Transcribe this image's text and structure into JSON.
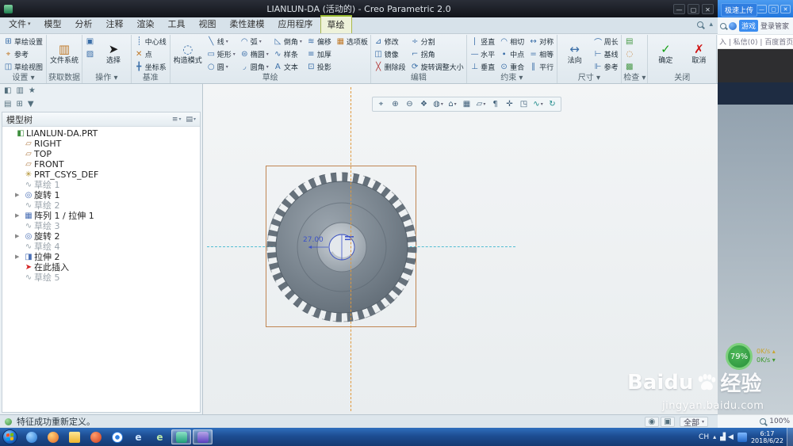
{
  "window": {
    "title": "LIANLUN-DA (活动的) - Creo Parametric 2.0",
    "controls": {
      "minimize": "—",
      "maximize": "▢",
      "close": "✕"
    }
  },
  "tabs": {
    "items": [
      {
        "name": "tab-file",
        "label": "文件",
        "dd": "▾"
      },
      {
        "name": "tab-model",
        "label": "模型"
      },
      {
        "name": "tab-analysis",
        "label": "分析"
      },
      {
        "name": "tab-annotate",
        "label": "注释"
      },
      {
        "name": "tab-render",
        "label": "渲染"
      },
      {
        "name": "tab-tools",
        "label": "工具"
      },
      {
        "name": "tab-view",
        "label": "视图"
      },
      {
        "name": "tab-flexible-modeling",
        "label": "柔性建模"
      },
      {
        "name": "tab-applications",
        "label": "应用程序"
      },
      {
        "name": "tab-sketch",
        "label": "草绘",
        "active": true
      }
    ],
    "collapse_icon": "▴"
  },
  "ribbon": {
    "groups": [
      {
        "label": "设置 ▾",
        "buttons": [
          {
            "n": "sketch-setup-button",
            "g": "⊞",
            "c": "icb",
            "t": "草绘设置"
          },
          {
            "n": "references-button",
            "g": "⌖",
            "c": "ico",
            "t": "参考"
          },
          {
            "n": "sketch-view-button",
            "g": "◫",
            "c": "icb",
            "t": "草绘视图"
          }
        ]
      },
      {
        "label": "获取数据",
        "buttons": [
          {
            "n": "file-system-button",
            "g": "▥",
            "c": "ico",
            "t": "文件系统",
            "big": true
          }
        ]
      },
      {
        "label": "操作 ▾",
        "buttons": [
          {
            "n": "copy-button",
            "g": "▣",
            "c": "icb"
          },
          {
            "n": "paste-button",
            "g": "▨",
            "c": "icb"
          },
          {
            "n": "select-button",
            "g": "➤",
            "c": "ick",
            "t": "选择",
            "big": true
          }
        ]
      },
      {
        "label": "基准",
        "buttons": [
          {
            "n": "centerline-button",
            "g": "┊",
            "c": "icb",
            "t": "中心线"
          },
          {
            "n": "point-button",
            "g": "✕",
            "c": "ico",
            "t": "点"
          },
          {
            "n": "coordinate-system-button",
            "g": "╋",
            "c": "icb",
            "t": "坐标系"
          }
        ]
      },
      {
        "label": "草绘",
        "buttons": [
          {
            "n": "construction-mode-button",
            "g": "◌",
            "c": "icb",
            "t": "构造模式",
            "big": true
          },
          {
            "n": "line-button",
            "g": "╲",
            "c": "icb",
            "t": "线",
            "dd": "▾"
          },
          {
            "n": "rectangle-button",
            "g": "▭",
            "c": "icb",
            "t": "矩形",
            "dd": "▾"
          },
          {
            "n": "circle-button",
            "g": "○",
            "c": "icb",
            "t": "圆",
            "dd": "▾"
          },
          {
            "n": "arc-button",
            "g": "◠",
            "c": "icb",
            "t": "弧",
            "dd": "▾"
          },
          {
            "n": "ellipse-button",
            "g": "⊜",
            "c": "icb",
            "t": "椭圆",
            "dd": "▾"
          },
          {
            "n": "fillet-button",
            "g": "◞",
            "c": "icb",
            "t": "圆角",
            "dd": "▾"
          },
          {
            "n": "chamfer-button",
            "g": "◺",
            "c": "icb",
            "t": "倒角",
            "dd": "▾"
          },
          {
            "n": "spline-button",
            "g": "∿",
            "c": "icb",
            "t": "样条"
          },
          {
            "n": "text-button",
            "g": "A",
            "c": "icb",
            "t": "文本"
          },
          {
            "n": "offset-button",
            "g": "≋",
            "c": "icb",
            "t": "偏移"
          },
          {
            "n": "thicken-button",
            "g": "≡",
            "c": "icb",
            "t": "加厚"
          },
          {
            "n": "project-button",
            "g": "⊡",
            "c": "icb",
            "t": "投影"
          },
          {
            "n": "palette-button",
            "g": "▦",
            "c": "ico",
            "t": "选项板"
          }
        ]
      },
      {
        "label": "编辑",
        "buttons": [
          {
            "n": "modify-button",
            "g": "⊿",
            "c": "icb",
            "t": "修改"
          },
          {
            "n": "mirror-button",
            "g": "◫",
            "c": "icb",
            "t": "镜像"
          },
          {
            "n": "delete-segment-button",
            "g": "╳",
            "c": "icr",
            "t": "删除段"
          },
          {
            "n": "divide-button",
            "g": "÷",
            "c": "icb",
            "t": "分割"
          },
          {
            "n": "corner-button",
            "g": "⌐",
            "c": "icb",
            "t": "拐角"
          },
          {
            "n": "rotate-resize-button",
            "g": "⟳",
            "c": "icb",
            "t": "旋转调整大小"
          }
        ]
      },
      {
        "label": "约束 ▾",
        "buttons": [
          {
            "n": "vertical-constraint-button",
            "g": "∣",
            "c": "icb",
            "t": "竖直"
          },
          {
            "n": "horizontal-constraint-button",
            "g": "—",
            "c": "icb",
            "t": "水平"
          },
          {
            "n": "perpendicular-constraint-button",
            "g": "⊥",
            "c": "icb",
            "t": "垂直"
          },
          {
            "n": "tangent-constraint-button",
            "g": "◠",
            "c": "icb",
            "t": "相切"
          },
          {
            "n": "midpoint-constraint-button",
            "g": "∙",
            "c": "icb",
            "t": "中点"
          },
          {
            "n": "coincident-constraint-button",
            "g": "⊙",
            "c": "icb",
            "t": "重合"
          },
          {
            "n": "symmetric-constraint-button",
            "g": "↔",
            "c": "icb",
            "t": "对称"
          },
          {
            "n": "equal-constraint-button",
            "g": "=",
            "c": "icb",
            "t": "相等"
          },
          {
            "n": "parallel-constraint-button",
            "g": "∥",
            "c": "icb",
            "t": "平行"
          }
        ]
      },
      {
        "label": "尺寸 ▾",
        "buttons": [
          {
            "n": "normal-dimension-button",
            "g": "↔",
            "c": "icb",
            "t": "法向",
            "big": true
          },
          {
            "n": "perimeter-dimension-button",
            "g": "⌒",
            "c": "icb",
            "t": "周长"
          },
          {
            "n": "baseline-dimension-button",
            "g": "⊢",
            "c": "icb",
            "t": "基线"
          },
          {
            "n": "reference-dimension-button",
            "g": "⊩",
            "c": "icb",
            "t": "参考"
          }
        ]
      },
      {
        "label": "检查 ▾",
        "buttons": [
          {
            "n": "overlapping-geometry-button",
            "g": "▤",
            "c": "icg"
          },
          {
            "n": "highlight-open-ends-button",
            "g": "◌",
            "c": "ico"
          },
          {
            "n": "shade-closed-loops-button",
            "g": "▩",
            "c": "icg"
          }
        ]
      },
      {
        "label": "关闭",
        "buttons": [
          {
            "n": "ok-button",
            "g": "✓",
            "c": "icok",
            "t": "确定",
            "big": true
          },
          {
            "n": "cancel-button",
            "g": "✗",
            "c": "iccancel",
            "t": "取消",
            "big": true
          }
        ]
      }
    ]
  },
  "model_tree": {
    "title": "模型树",
    "header_icons": [
      {
        "n": "tree-show-button",
        "g": "≡",
        "dd": "▾"
      },
      {
        "n": "tree-settings-button",
        "g": "▤",
        "dd": "▾"
      }
    ],
    "navrow1": [
      {
        "n": "navigator-panel-icon",
        "g": "◧"
      },
      {
        "n": "folder-browser-icon",
        "g": "▥"
      },
      {
        "n": "favorites-icon",
        "g": "★"
      }
    ],
    "navrow2": [
      {
        "n": "tree-columns-icon",
        "g": "▤"
      },
      {
        "n": "tree-expand-all-icon",
        "g": "⊞"
      },
      {
        "n": "tree-filter-icon",
        "g": "▼"
      }
    ],
    "items": [
      {
        "n": "tree-item-part",
        "tw": "",
        "g": "◧",
        "c": "tic-part",
        "t": "LIANLUN-DA.PRT",
        "lvl": "lvl0"
      },
      {
        "n": "tree-item-right-plane",
        "tw": "",
        "g": "▱",
        "c": "tic-plane",
        "t": "RIGHT",
        "lvl": "lvl1"
      },
      {
        "n": "tree-item-top-plane",
        "tw": "",
        "g": "▱",
        "c": "tic-plane",
        "t": "TOP",
        "lvl": "lvl1"
      },
      {
        "n": "tree-item-front-plane",
        "tw": "",
        "g": "▱",
        "c": "tic-plane",
        "t": "FRONT",
        "lvl": "lvl1"
      },
      {
        "n": "tree-item-csys",
        "tw": "",
        "g": "✳",
        "c": "tic-csys",
        "t": "PRT_CSYS_DEF",
        "lvl": "lvl1"
      },
      {
        "n": "tree-item-sketch-1",
        "tw": "",
        "g": "∿",
        "c": "tic-sketch",
        "t": "草绘 1",
        "lvl": "lvl1",
        "dim": true
      },
      {
        "n": "tree-item-revolve-1",
        "tw": "▶",
        "g": "◎",
        "c": "tic-feat",
        "t": "旋转 1",
        "lvl": "lvl1"
      },
      {
        "n": "tree-item-sketch-2",
        "tw": "",
        "g": "∿",
        "c": "tic-sketch",
        "t": "草绘 2",
        "lvl": "lvl1",
        "dim": true
      },
      {
        "n": "tree-item-pattern-1",
        "tw": "▶",
        "g": "▦",
        "c": "tic-feat",
        "t": "阵列 1 / 拉伸 1",
        "lvl": "lvl1"
      },
      {
        "n": "tree-item-sketch-3",
        "tw": "",
        "g": "∿",
        "c": "tic-sketch",
        "t": "草绘 3",
        "lvl": "lvl1",
        "dim": true
      },
      {
        "n": "tree-item-revolve-2",
        "tw": "▶",
        "g": "◎",
        "c": "tic-feat",
        "t": "旋转 2",
        "lvl": "lvl1"
      },
      {
        "n": "tree-item-sketch-4",
        "tw": "",
        "g": "∿",
        "c": "tic-sketch",
        "t": "草绘 4",
        "lvl": "lvl1",
        "dim": true
      },
      {
        "n": "tree-item-extrude-2",
        "tw": "▶",
        "g": "◨",
        "c": "tic-feat",
        "t": "拉伸 2",
        "lvl": "lvl1"
      },
      {
        "n": "tree-item-insert-here",
        "tw": "",
        "g": "➤",
        "c": "tic-insert",
        "t": "在此插入",
        "lvl": "lvl1"
      },
      {
        "n": "tree-item-sketch-5",
        "tw": "",
        "g": "∿",
        "c": "tic-sketch",
        "t": "草绘 5",
        "lvl": "lvl1",
        "dim": true
      }
    ]
  },
  "graphics_toolbar": [
    {
      "n": "refit-icon",
      "g": "⌖"
    },
    {
      "n": "zoom-in-icon",
      "g": "⊕"
    },
    {
      "n": "zoom-out-icon",
      "g": "⊖"
    },
    {
      "n": "repaint-icon",
      "g": "❖"
    },
    {
      "n": "display-style-icon",
      "g": "◍",
      "dd": "▾"
    },
    {
      "n": "saved-orientations-icon",
      "g": "⌂",
      "dd": "▾"
    },
    {
      "n": "view-manager-icon",
      "g": "▦"
    },
    {
      "n": "datum-display-icon",
      "g": "▱",
      "dd": "▾"
    },
    {
      "n": "annotation-display-icon",
      "g": "¶"
    },
    {
      "n": "spin-center-icon",
      "g": "✛"
    },
    {
      "n": "perspective-icon",
      "g": "◳"
    },
    {
      "n": "sketcher-display-icon",
      "g": "∿",
      "c": "teal",
      "dd": "▾"
    },
    {
      "n": "sketch-orientation-icon",
      "g": "↻",
      "c": "teal"
    }
  ],
  "canvas": {
    "dimension_label": "27.00"
  },
  "statusbar": {
    "message": "特征成功重新定义。",
    "icons": [
      {
        "n": "status-find-icon",
        "g": "◉"
      },
      {
        "n": "status-clipboard-icon",
        "g": "▣"
      }
    ],
    "filter_label": "全部",
    "filter_arrow": "▾"
  },
  "side_panel": {
    "controls": {
      "minimize": "—",
      "maximize": "▢",
      "close": "✕"
    },
    "tooltip": "极速上传",
    "game_button": "游戏",
    "login_button": "登录管家",
    "account_line": "入 | 私信(0) | 百度首页",
    "gauge_percent": "79%",
    "up_speed": "0K/s ▴",
    "down_speed": "0K/s ▾",
    "zoom_label": "100%"
  },
  "watermark": {
    "brand": "Baidu",
    "suffix": "经验",
    "url": "jingyan.baidu.com"
  },
  "taskbar": {
    "lang": "CH",
    "hidden_icons": "▴",
    "time": "6:17",
    "date": "2018/6/22",
    "apps": [
      {
        "n": "taskbar-qq-icon",
        "c": "tb1"
      },
      {
        "n": "taskbar-firefox-icon",
        "c": "tb2"
      },
      {
        "n": "taskbar-folder-icon",
        "c": "tb3"
      },
      {
        "n": "taskbar-uc-icon",
        "c": "tb4"
      },
      {
        "n": "taskbar-baidu-icon",
        "c": "tb5"
      },
      {
        "n": "taskbar-ie-icon",
        "c": "tb6",
        "g": "e"
      },
      {
        "n": "taskbar-app-icon",
        "c": "tb7",
        "g": "e"
      },
      {
        "n": "taskbar-creo-icon",
        "c": "tb8",
        "open": true
      },
      {
        "n": "taskbar-browser-icon",
        "c": "tb9",
        "open": true
      }
    ],
    "tray_icons": [
      {
        "n": "tray-network-icon",
        "g": "▟"
      },
      {
        "n": "tray-volume-icon",
        "g": "◀"
      }
    ]
  }
}
